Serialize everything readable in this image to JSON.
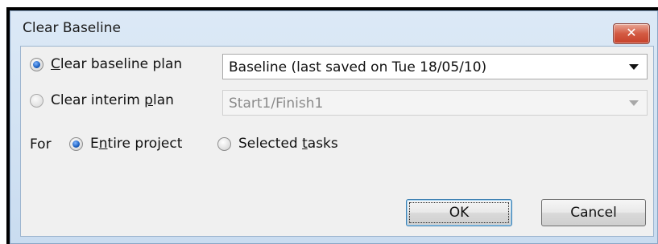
{
  "dialog": {
    "title": "Clear Baseline",
    "close_label": "✕"
  },
  "options": {
    "clear_baseline_plan": {
      "pre": "",
      "mnemonic": "C",
      "post": "lear baseline plan",
      "checked": true
    },
    "clear_interim_plan": {
      "pre": "Clear interim ",
      "mnemonic": "p",
      "post": "lan",
      "checked": false
    }
  },
  "combos": {
    "baseline": {
      "value": "Baseline (last saved on Tue 18/05/10)",
      "enabled": true
    },
    "interim": {
      "value": "Start1/Finish1",
      "enabled": false
    }
  },
  "scope": {
    "label": "For",
    "entire_project": {
      "pre": "E",
      "mnemonic": "n",
      "post": "tire project",
      "checked": true
    },
    "selected_tasks": {
      "pre": "Selected ",
      "mnemonic": "t",
      "post": "asks",
      "checked": false
    }
  },
  "buttons": {
    "ok": "OK",
    "cancel": "Cancel"
  },
  "colors": {
    "title_gradient_top": "#dce9f6",
    "close_red": "#c6412a",
    "radio_selected": "#1b5fbf"
  }
}
